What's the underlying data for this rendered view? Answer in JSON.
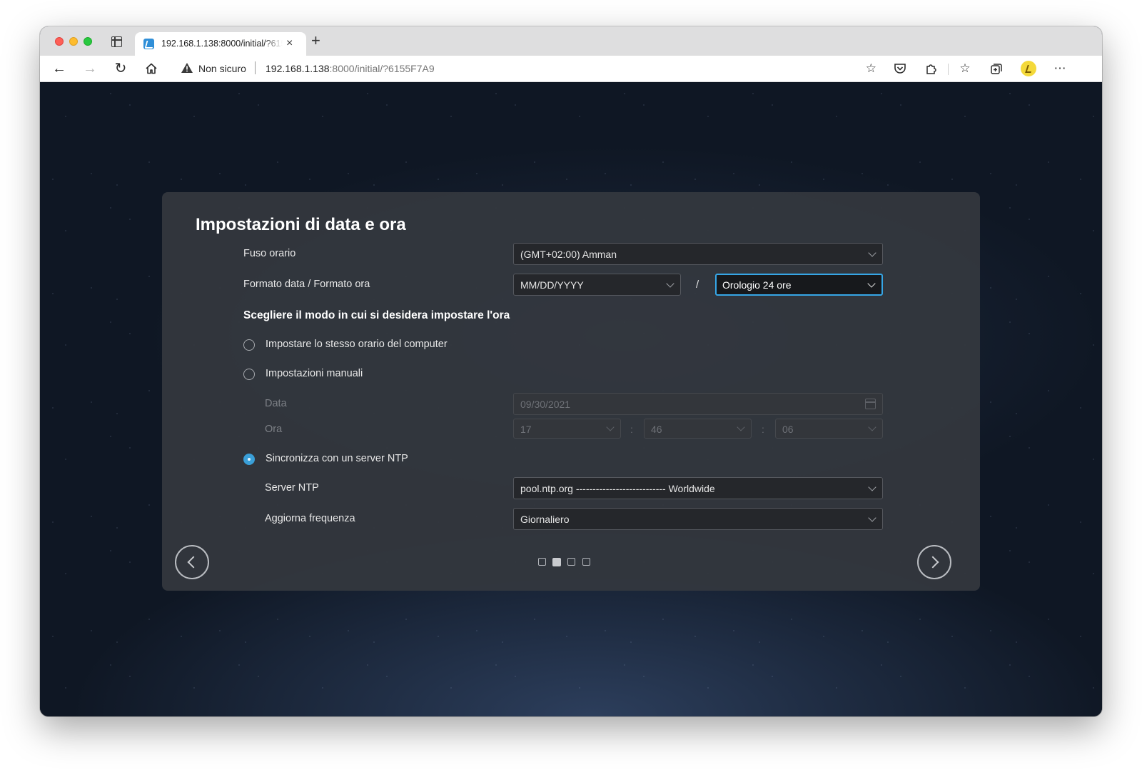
{
  "browser": {
    "tab_title": "192.168.1.138:8000/initial/?6155F7A9",
    "tab_close": "×",
    "new_tab": "+",
    "not_secure_label": "Non sicuro",
    "url_host": "192.168.1.138",
    "url_rest": ":8000/initial/?6155F7A9",
    "icons": {
      "back": "back-arrow-icon",
      "forward": "forward-arrow-icon",
      "reload": "reload-icon",
      "home": "home-icon",
      "warning": "warning-icon",
      "favorite_add": "favorite-add-icon",
      "pocket": "pocket-icon",
      "extensions": "extensions-icon",
      "favorites": "favorites-icon",
      "collections": "collections-icon",
      "profile": "profile-icon",
      "more": "more-icon"
    }
  },
  "panel": {
    "title": "Impostazioni di data e ora",
    "timezone": {
      "label": "Fuso orario",
      "value": "(GMT+02:00) Amman"
    },
    "format": {
      "label": "Formato data / Formato ora",
      "date_value": "MM/DD/YYYY",
      "separator": "/",
      "time_value": "Orologio 24 ore"
    },
    "section_title": "Scegliere il modo in cui si desidera impostare l'ora",
    "options": {
      "same_as_computer": {
        "label": "Impostare lo stesso orario del computer",
        "checked": false
      },
      "manual": {
        "label": "Impostazioni manuali",
        "checked": false
      },
      "ntp": {
        "label": "Sincronizza con un server NTP",
        "checked": true
      }
    },
    "manual": {
      "date_label": "Data",
      "date_value": "09/30/2021",
      "time_label": "Ora",
      "hour": "17",
      "minute": "46",
      "second": "06",
      "time_separator": ":"
    },
    "ntp_server": {
      "label": "Server NTP",
      "value": "pool.ntp.org --------------------------- Worldwide"
    },
    "update_frequency": {
      "label": "Aggiorna frequenza",
      "value": "Giornaliero"
    },
    "pagination": {
      "total": 4,
      "current": 2
    }
  },
  "colors": {
    "accent": "#36a6e6",
    "panel_bg": "#34383e",
    "page_bg": "#0f1724"
  }
}
